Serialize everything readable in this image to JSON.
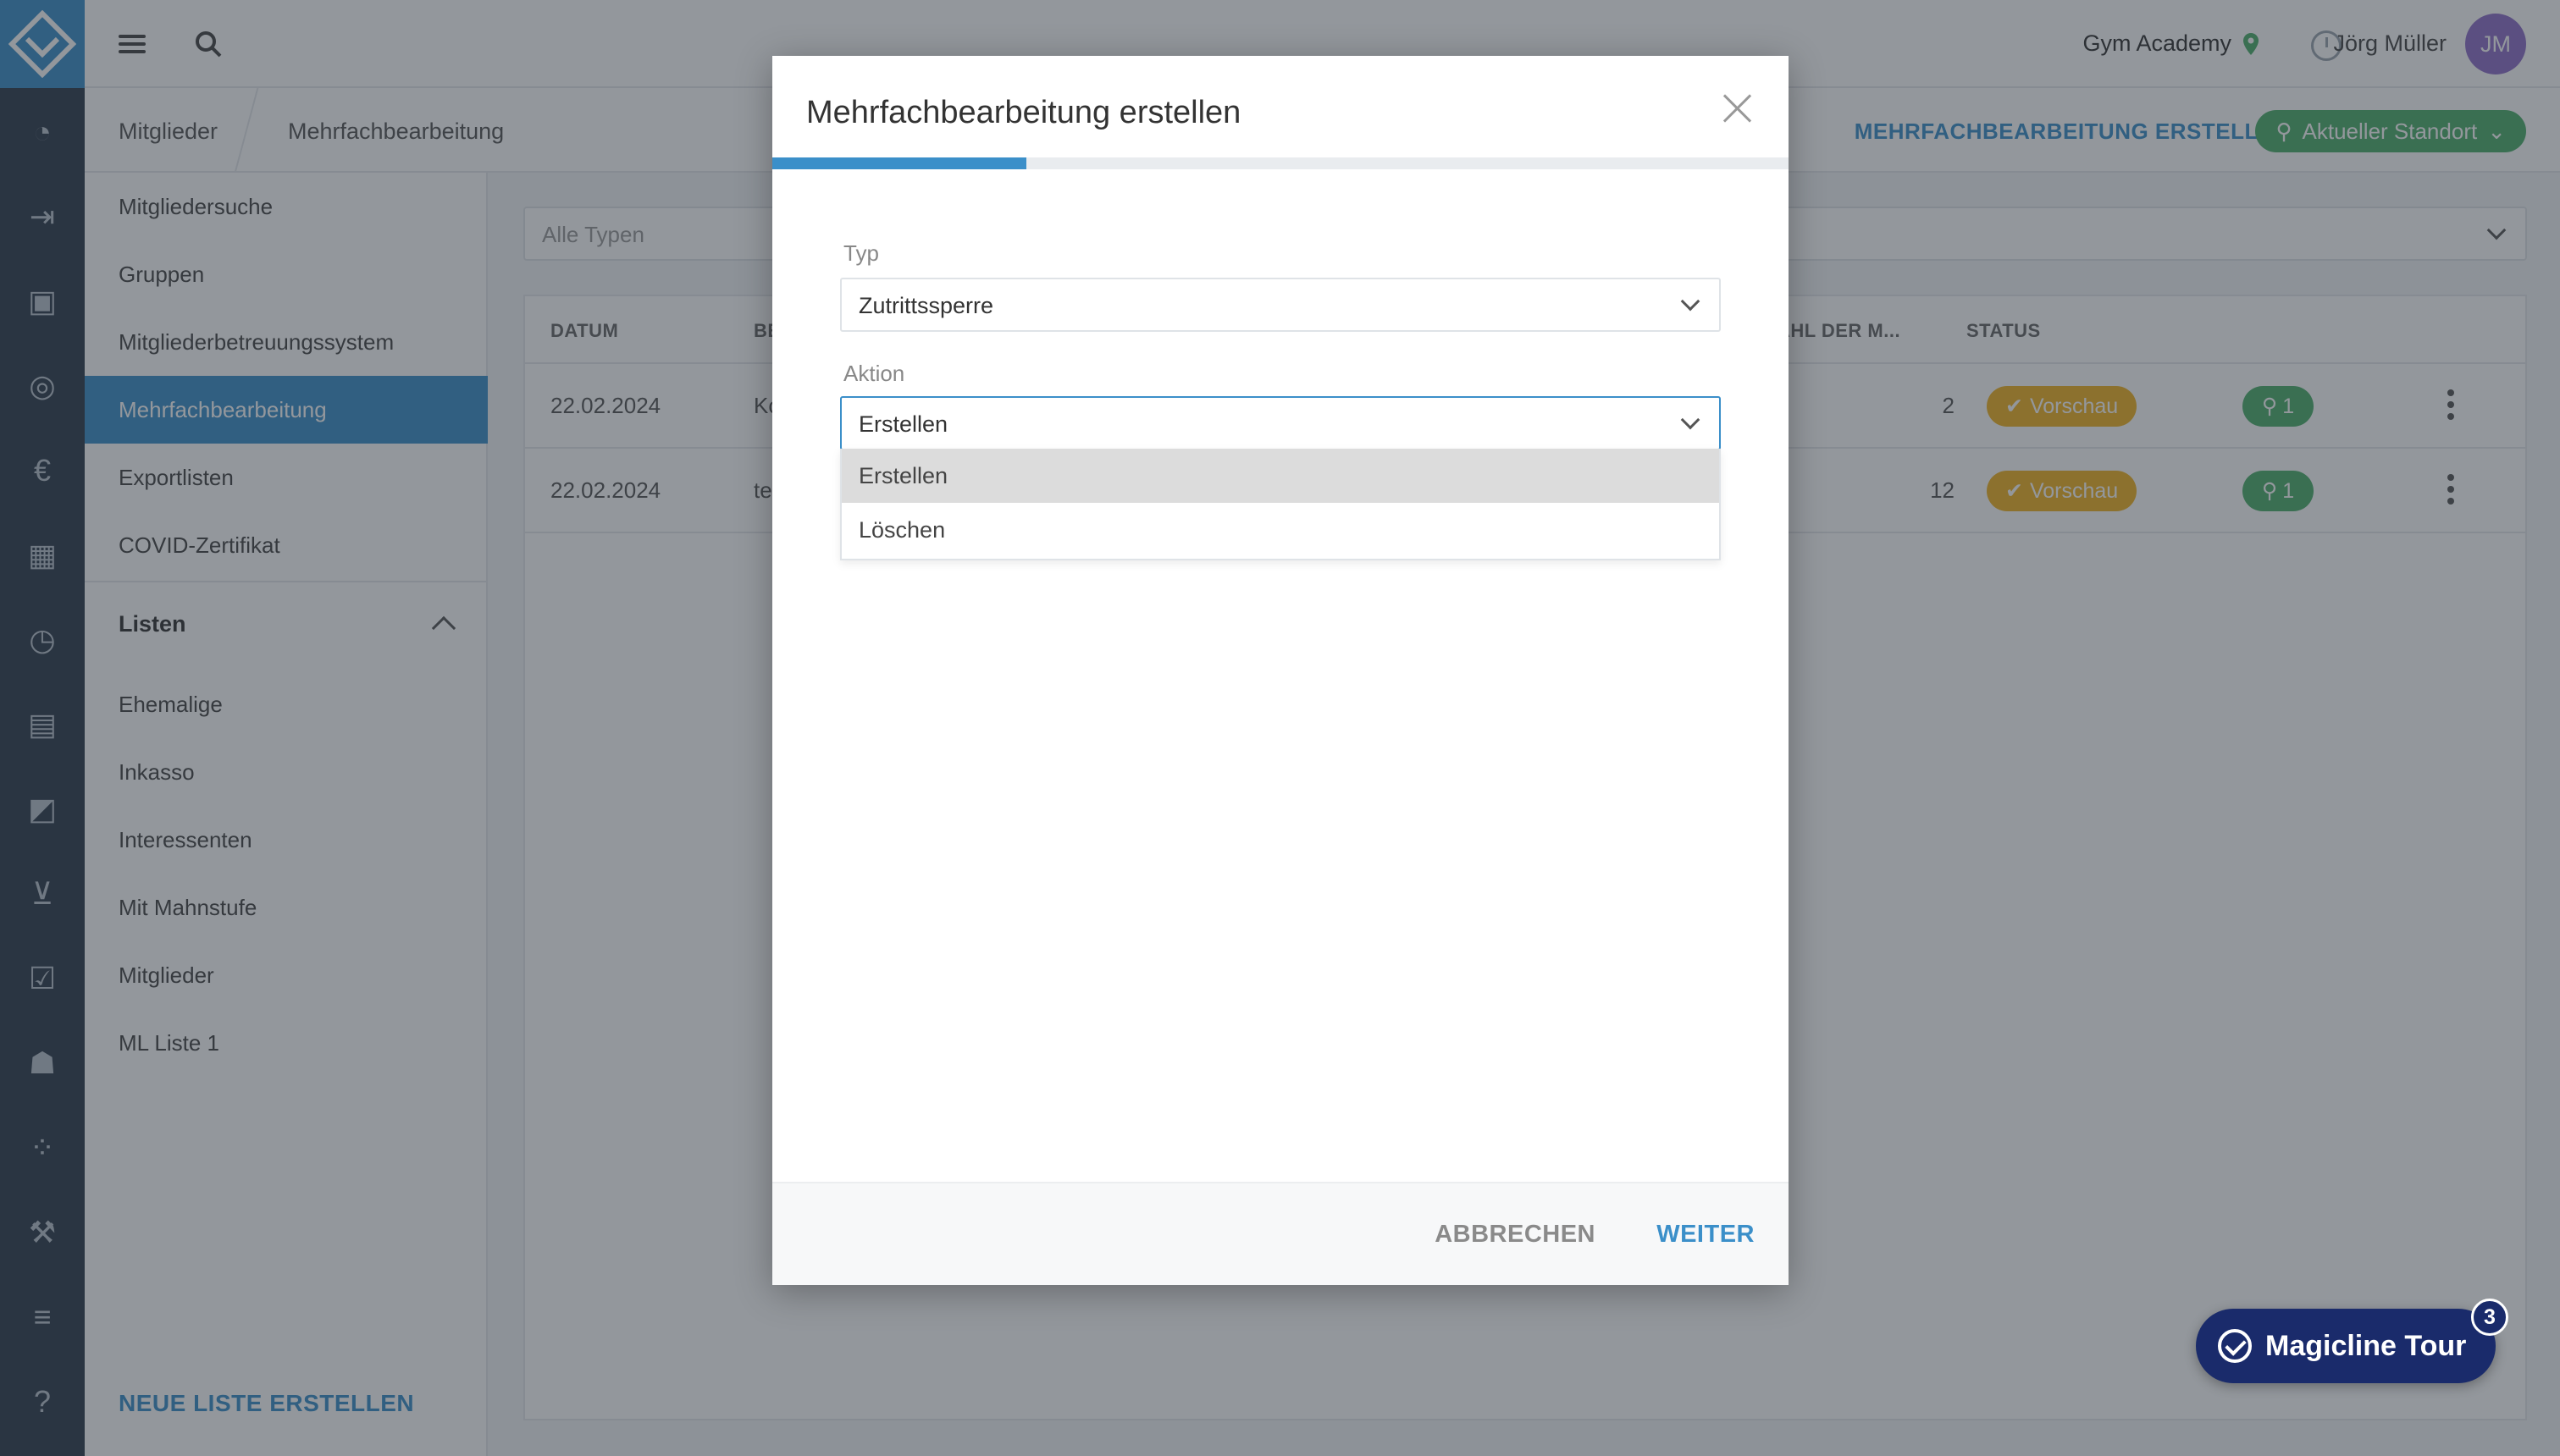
{
  "topbar": {
    "studio_name": "Gym Academy",
    "user_name": "Jörg Müller",
    "avatar_initials": "JM"
  },
  "breadcrumb": {
    "items": [
      "Mitglieder",
      "Mehrfachbearbeitung"
    ],
    "action_label": "MEHRFACHBEARBEITUNG ERSTELLEN",
    "location_label": "Aktueller Standort"
  },
  "rail_icons": [
    "dashboard-icon",
    "checkin-icon",
    "member-card-icon",
    "settings-ring-icon",
    "euro-icon",
    "calendar-icon",
    "timer-icon",
    "chat-icon",
    "chart-icon",
    "cart-icon",
    "checkbox-icon",
    "group-icon",
    "grid-dots-icon",
    "dumbbell-icon",
    "sliders-icon",
    "help-icon"
  ],
  "sidebar": {
    "items": [
      {
        "label": "Mitgliedersuche"
      },
      {
        "label": "Gruppen"
      },
      {
        "label": "Mitgliederbetreuungssystem"
      },
      {
        "label": "Mehrfachbearbeitung",
        "active": true
      },
      {
        "label": "Exportlisten"
      },
      {
        "label": "COVID-Zertifikat"
      }
    ],
    "lists_heading": "Listen",
    "lists": [
      {
        "label": "Ehemalige"
      },
      {
        "label": "Inkasso"
      },
      {
        "label": "Interessenten"
      },
      {
        "label": "Mit Mahnstufe"
      },
      {
        "label": "Mitglieder"
      },
      {
        "label": "ML Liste 1"
      }
    ],
    "new_list_label": "NEUE LISTE ERSTELLEN"
  },
  "main": {
    "filter_placeholder": "Alle Typen",
    "table": {
      "headers": [
        "DATUM",
        "BE",
        "ZAHL DER M...",
        "STATUS"
      ],
      "rows": [
        {
          "date": "22.02.2024",
          "desc": "Ko",
          "count": "2",
          "status": "Vorschau",
          "locations": "1"
        },
        {
          "date": "22.02.2024",
          "desc": "te",
          "count": "12",
          "status": "Vorschau",
          "locations": "1"
        }
      ]
    }
  },
  "modal": {
    "title": "Mehrfachbearbeitung erstellen",
    "progress": 0.25,
    "typ_label": "Typ",
    "typ_value": "Zutrittssperre",
    "aktion_label": "Aktion",
    "aktion_value": "Erstellen",
    "aktion_options": [
      "Erstellen",
      "Löschen"
    ],
    "cancel_label": "ABBRECHEN",
    "next_label": "WEITER"
  },
  "tour": {
    "label": "Magicline Tour",
    "count": "3"
  },
  "colors": {
    "accent": "#3b8fc9",
    "rail": "#2d3a4a",
    "success": "#4caf6a",
    "warning": "#f0b323",
    "tour": "#1a2b6b"
  }
}
